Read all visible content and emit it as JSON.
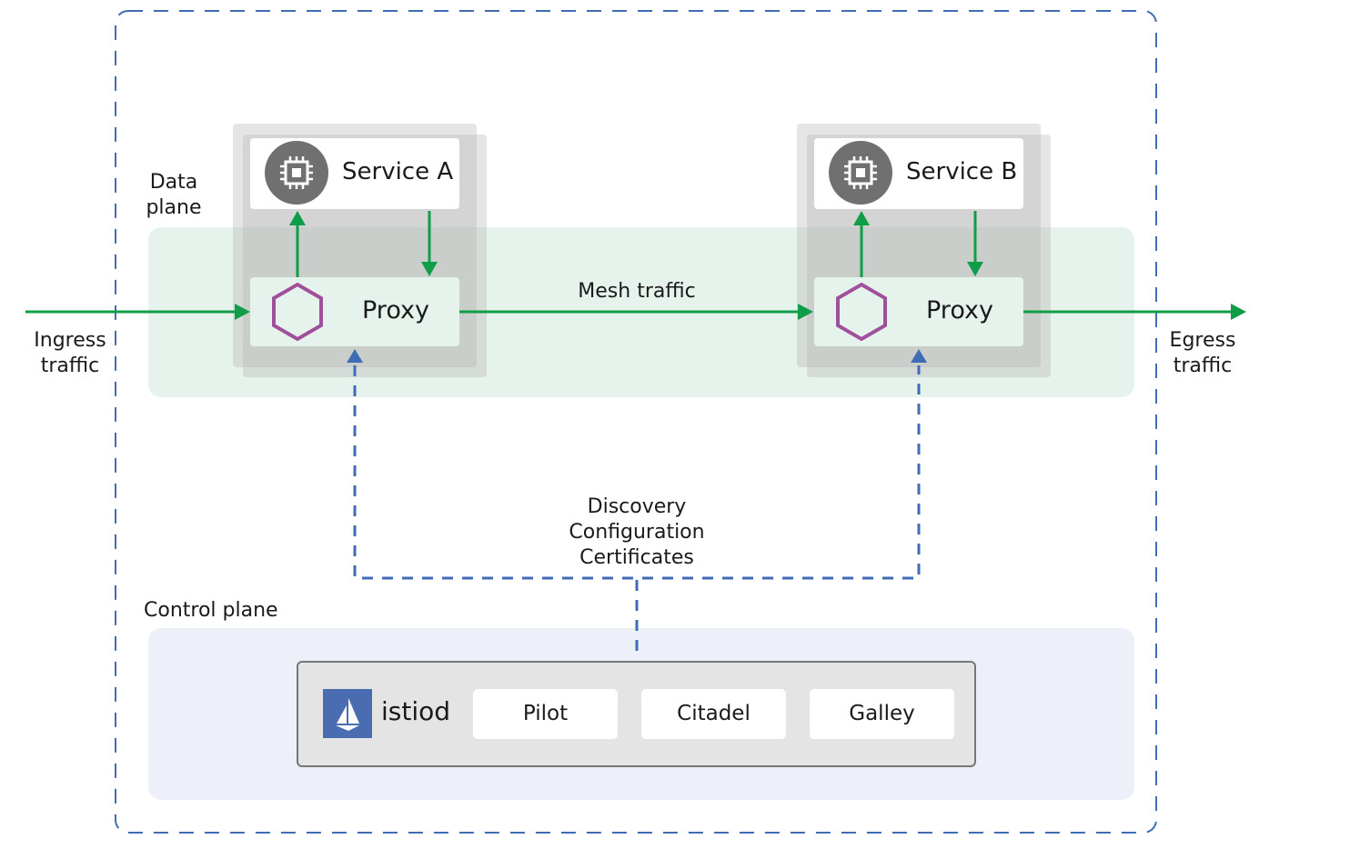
{
  "data_plane": {
    "label_line1": "Data",
    "label_line2": "plane"
  },
  "control_plane": {
    "label": "Control plane"
  },
  "service_a": {
    "label": "Service A",
    "icon": "chip-icon",
    "proxy_label": "Proxy"
  },
  "service_b": {
    "label": "Service B",
    "icon": "chip-icon",
    "proxy_label": "Proxy"
  },
  "mesh_traffic": "Mesh traffic",
  "ingress": {
    "line1": "Ingress",
    "line2": "traffic"
  },
  "egress": {
    "line1": "Egress",
    "line2": "traffic"
  },
  "control_flow": {
    "line1": "Discovery",
    "line2": "Configuration",
    "line3": "Certificates"
  },
  "istiod": {
    "label": "istiod",
    "components": [
      "Pilot",
      "Citadel",
      "Galley"
    ]
  },
  "colors": {
    "traffic": "#0f9d48",
    "control": "#3f6cb5",
    "proxy_icon": "#a0509a",
    "service_icon": "#707070",
    "data_plane_bg": "#e6f2ec",
    "control_plane_bg": "#edf0f8",
    "istio_logo": "#4a6cb0"
  }
}
